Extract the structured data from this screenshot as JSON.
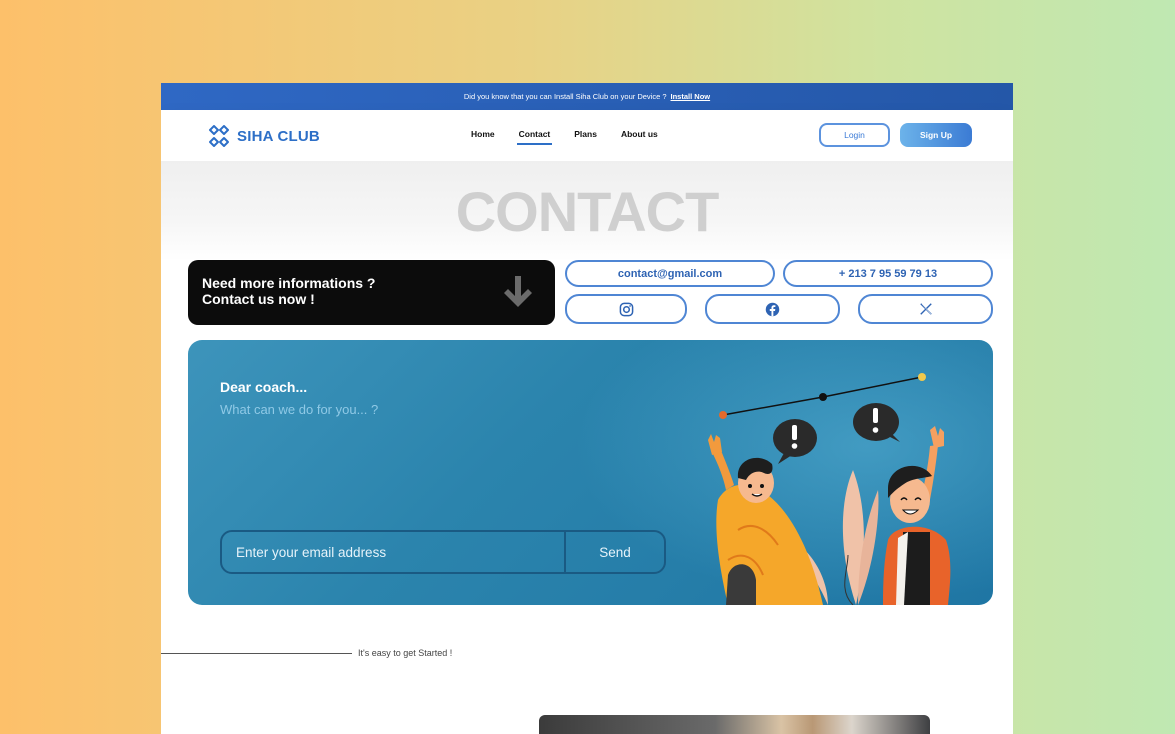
{
  "announcement": {
    "text": "Did you know that you can Install Siha Club on your Device ?",
    "link": "Install Now"
  },
  "brand": {
    "name": "SIHA CLUB",
    "color": "#2d6fc7"
  },
  "nav": {
    "links": [
      {
        "label": "Home",
        "active": false
      },
      {
        "label": "Contact",
        "active": true
      },
      {
        "label": "Plans",
        "active": false
      },
      {
        "label": "About us",
        "active": false
      }
    ],
    "login_label": "Login",
    "signup_label": "Sign Up"
  },
  "hero": {
    "title": "CONTACT"
  },
  "contact_card": {
    "line1": "Need more informations ?",
    "line2": "Contact us now !",
    "icon": "arrow-down-icon"
  },
  "contact_pills": {
    "email": "contact@gmail.com",
    "phone": "+ 213 7 95 59 79 13"
  },
  "socials": [
    {
      "icon": "instagram-icon"
    },
    {
      "icon": "facebook-icon"
    },
    {
      "icon": "x-icon"
    }
  ],
  "banner": {
    "greeting": "Dear coach...",
    "question": "What can we do for you... ?",
    "email_placeholder": "Enter your email address",
    "send_label": "Send"
  },
  "section_label": "It's easy to get Started !"
}
